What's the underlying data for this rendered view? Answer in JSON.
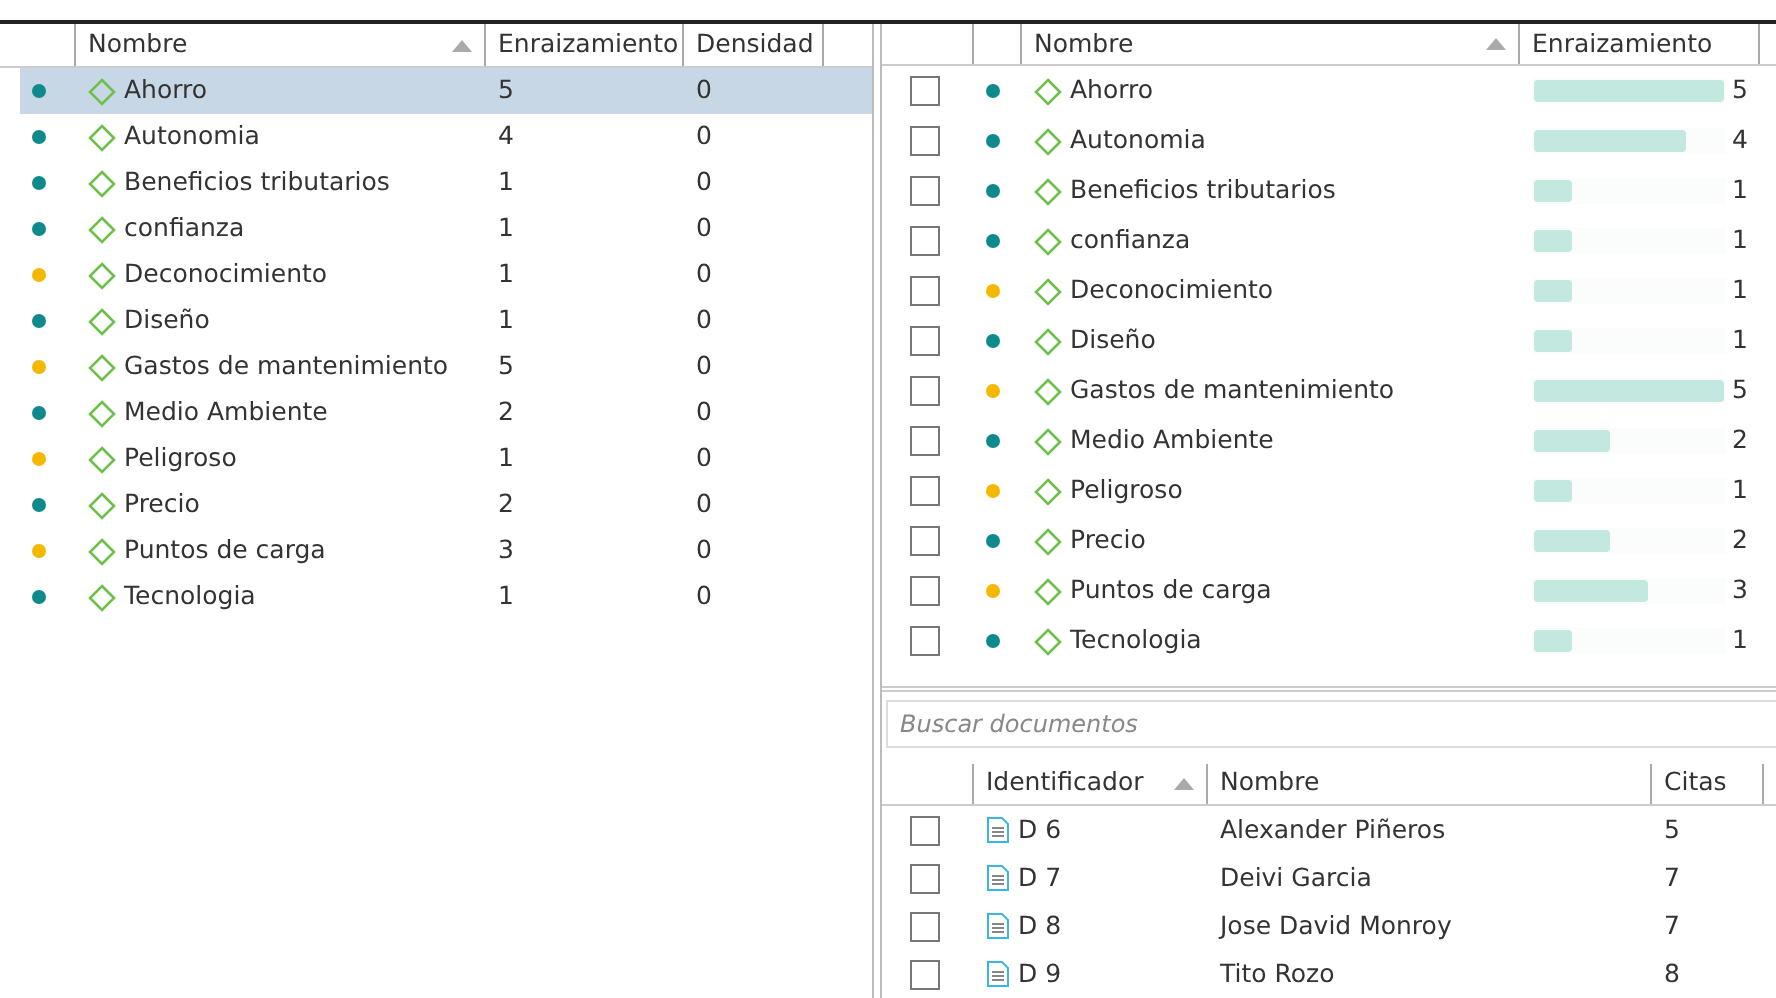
{
  "codes_table": {
    "columns": [
      {
        "label": "Nombre",
        "sorted": true
      },
      {
        "label": "Enraizamiento",
        "sorted": false
      },
      {
        "label": "Densidad",
        "sorted": false
      }
    ],
    "rows": [
      {
        "name": "Ahorro",
        "color": "#0e8a8c",
        "grounded": "5",
        "density": "0",
        "selected": true
      },
      {
        "name": "Autonomia",
        "color": "#0e8a8c",
        "grounded": "4",
        "density": "0",
        "selected": false
      },
      {
        "name": "Beneficios tributarios",
        "color": "#0e8a8c",
        "grounded": "1",
        "density": "0",
        "selected": false
      },
      {
        "name": "confianza",
        "color": "#0e8a8c",
        "grounded": "1",
        "density": "0",
        "selected": false
      },
      {
        "name": "Deconocimiento",
        "color": "#f5b800",
        "grounded": "1",
        "density": "0",
        "selected": false
      },
      {
        "name": "Diseño",
        "color": "#0e8a8c",
        "grounded": "1",
        "density": "0",
        "selected": false
      },
      {
        "name": "Gastos de mantenimiento",
        "color": "#f5b800",
        "grounded": "5",
        "density": "0",
        "selected": false
      },
      {
        "name": "Medio Ambiente",
        "color": "#0e8a8c",
        "grounded": "2",
        "density": "0",
        "selected": false
      },
      {
        "name": "Peligroso",
        "color": "#f5b800",
        "grounded": "1",
        "density": "0",
        "selected": false
      },
      {
        "name": "Precio",
        "color": "#0e8a8c",
        "grounded": "2",
        "density": "0",
        "selected": false
      },
      {
        "name": "Puntos de carga",
        "color": "#f5b800",
        "grounded": "3",
        "density": "0",
        "selected": false
      },
      {
        "name": "Tecnologia",
        "color": "#0e8a8c",
        "grounded": "1",
        "density": "0",
        "selected": false
      }
    ]
  },
  "code_checklist": {
    "columns": [
      {
        "label": "Nombre",
        "sorted": true
      },
      {
        "label": "Enraizamiento",
        "sorted": false
      }
    ],
    "rows": [
      {
        "checked": false,
        "color": "#0e8a8c",
        "name": "Ahorro",
        "level": 1.0,
        "grounded": "5"
      },
      {
        "checked": false,
        "color": "#0e8a8c",
        "name": "Autonomia",
        "level": 0.8,
        "grounded": "4"
      },
      {
        "checked": false,
        "color": "#0e8a8c",
        "name": "Beneficios tributarios",
        "level": 0.2,
        "grounded": "1"
      },
      {
        "checked": false,
        "color": "#0e8a8c",
        "name": "confianza",
        "level": 0.2,
        "grounded": "1"
      },
      {
        "checked": false,
        "color": "#f5b800",
        "name": "Deconocimiento",
        "level": 0.2,
        "grounded": "1"
      },
      {
        "checked": false,
        "color": "#0e8a8c",
        "name": "Diseño",
        "level": 0.2,
        "grounded": "1"
      },
      {
        "checked": false,
        "color": "#f5b800",
        "name": "Gastos de mantenimiento",
        "level": 1.0,
        "grounded": "5"
      },
      {
        "checked": false,
        "color": "#0e8a8c",
        "name": "Medio Ambiente",
        "level": 0.4,
        "grounded": "2"
      },
      {
        "checked": false,
        "color": "#f5b800",
        "name": "Peligroso",
        "level": 0.2,
        "grounded": "1"
      },
      {
        "checked": false,
        "color": "#0e8a8c",
        "name": "Precio",
        "level": 0.4,
        "grounded": "2"
      },
      {
        "checked": false,
        "color": "#f5b800",
        "name": "Puntos de carga",
        "level": 0.6,
        "grounded": "3"
      },
      {
        "checked": false,
        "color": "#0e8a8c",
        "name": "Tecnologia",
        "level": 0.2,
        "grounded": "1"
      }
    ]
  },
  "document_search": {
    "placeholder": "Buscar documentos"
  },
  "documents_table": {
    "columns": [
      {
        "label": "Identificador",
        "sorted": true
      },
      {
        "label": "Nombre",
        "sorted": false
      },
      {
        "label": "Citas",
        "sorted": false
      }
    ],
    "rows": [
      {
        "checked": false,
        "id": "D 6",
        "name": "Alexander Piñeros",
        "quotes": "5"
      },
      {
        "checked": false,
        "id": "D 7",
        "name": "Deivi Garcia",
        "quotes": "7"
      },
      {
        "checked": false,
        "id": "D 8",
        "name": "Jose David Monroy",
        "quotes": "7"
      },
      {
        "checked": false,
        "id": "D 9",
        "name": "Tito Rozo",
        "quotes": "8"
      }
    ]
  }
}
